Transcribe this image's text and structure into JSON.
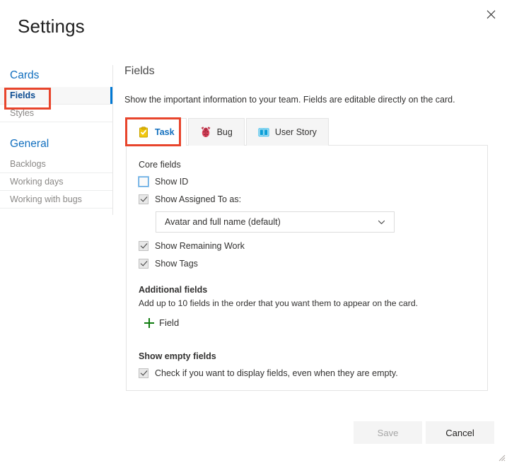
{
  "window": {
    "title": "Settings",
    "close_icon": "close-icon",
    "resize_grip_icon": "resize-grip-icon"
  },
  "sidebar": {
    "groups": [
      {
        "title": "Cards",
        "items": [
          {
            "label": "Fields",
            "selected": true
          },
          {
            "label": "Styles",
            "selected": false
          }
        ]
      },
      {
        "title": "General",
        "items": [
          {
            "label": "Backlogs",
            "selected": false
          },
          {
            "label": "Working days",
            "selected": false
          },
          {
            "label": "Working with bugs",
            "selected": false
          }
        ]
      }
    ]
  },
  "main": {
    "heading": "Fields",
    "description": "Show the important information to your team. Fields are editable directly on the card.",
    "tabs": [
      {
        "label": "Task",
        "icon": "task-clipboard-icon",
        "active": true
      },
      {
        "label": "Bug",
        "icon": "bug-ladybug-icon",
        "active": false
      },
      {
        "label": "User Story",
        "icon": "user-story-book-icon",
        "active": false
      }
    ],
    "core_fields": {
      "label": "Core fields",
      "checkboxes": [
        {
          "label": "Show ID",
          "checked": false,
          "focused": true
        },
        {
          "label": "Show Assigned To as:",
          "checked": true,
          "focused": false
        },
        {
          "label": "Show Remaining Work",
          "checked": true,
          "focused": false
        },
        {
          "label": "Show Tags",
          "checked": true,
          "focused": false
        }
      ],
      "assigned_to_dropdown": {
        "value": "Avatar and full name (default)",
        "chevron_icon": "chevron-down-icon"
      }
    },
    "additional_fields": {
      "label": "Additional fields",
      "description": "Add up to 10 fields in the order that you want them to appear on the card.",
      "add_button_label": "Field",
      "add_button_icon": "plus-icon"
    },
    "show_empty_fields": {
      "label": "Show empty fields",
      "checkbox": {
        "label": "Check if you want to display fields, even when they are empty.",
        "checked": true
      }
    }
  },
  "footer": {
    "save_label": "Save",
    "cancel_label": "Cancel"
  },
  "colors": {
    "accent_blue": "#0078d4",
    "link_blue": "#106ebe",
    "highlight_red": "#e8452c",
    "plus_green": "#107c10",
    "task_yellow": "#f2c811",
    "bug_red": "#d13438",
    "story_blue": "#009ccc"
  }
}
